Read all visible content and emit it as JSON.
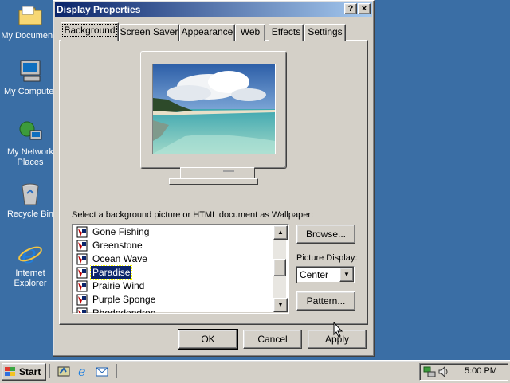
{
  "desktop": {
    "icons": [
      {
        "name": "my-documents",
        "label": "My Documents"
      },
      {
        "name": "my-computer",
        "label": "My Computer"
      },
      {
        "name": "my-network-places",
        "label_line1": "My Network",
        "label_line2": "Places"
      },
      {
        "name": "recycle-bin",
        "label": "Recycle Bin"
      },
      {
        "name": "internet-explorer",
        "label_line1": "Internet",
        "label_line2": "Explorer"
      }
    ]
  },
  "window": {
    "title": "Display Properties",
    "help_button": "?",
    "close_button": "×",
    "tabs": [
      "Background",
      "Screen Saver",
      "Appearance",
      "Web",
      "Effects",
      "Settings"
    ],
    "active_tab": "Background",
    "wallpaper_prompt": "Select a background picture or HTML document as Wallpaper:",
    "wallpapers": [
      "Gone Fishing",
      "Greenstone",
      "Ocean Wave",
      "Paradise",
      "Prairie Wind",
      "Purple Sponge",
      "Rhododendron"
    ],
    "selected_wallpaper": "Paradise",
    "browse_label": "Browse...",
    "picture_display_label": "Picture Display:",
    "picture_display_value": "Center",
    "pattern_label": "Pattern...",
    "ok_label": "OK",
    "cancel_label": "Cancel",
    "apply_label": "Apply"
  },
  "taskbar": {
    "start_label": "Start",
    "quick_launch": [
      "show-desktop-icon",
      "internet-explorer-icon",
      "outlook-express-icon"
    ],
    "clock": "5:00 PM"
  },
  "colors": {
    "desktop": "#3a6ea5",
    "face": "#d4d0c8",
    "titlebar_start": "#0a246a",
    "titlebar_end": "#a6caf0",
    "selection": "#0a246a"
  }
}
